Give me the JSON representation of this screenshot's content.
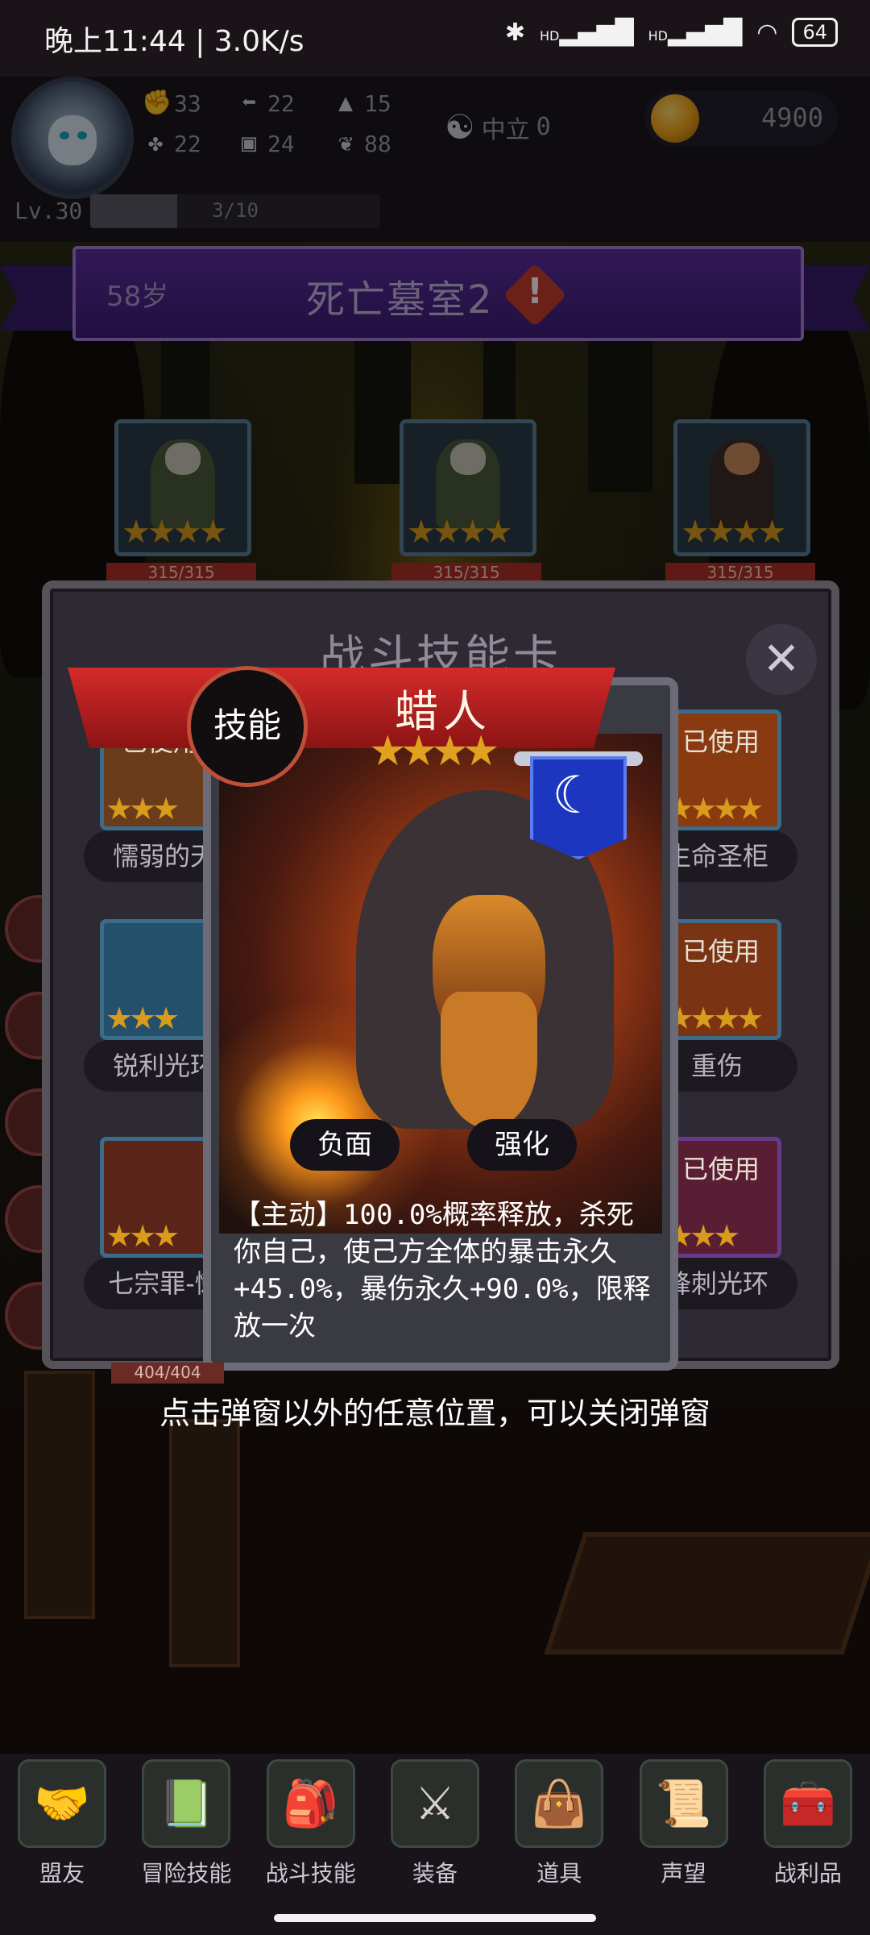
{
  "status_bar": {
    "time": "晚上11:44 | 3.0K/s",
    "signal_text": "HD",
    "battery": "64"
  },
  "hud": {
    "stats": [
      {
        "icon": "fist-icon",
        "value": "33"
      },
      {
        "icon": "boot-icon",
        "value": "22"
      },
      {
        "icon": "wizard-hat-icon",
        "value": "15"
      },
      {
        "icon": "clover-icon",
        "value": "22"
      },
      {
        "icon": "bag-icon",
        "value": "24"
      },
      {
        "icon": "lotus-icon",
        "value": "88"
      }
    ],
    "alignment_label": "中立",
    "alignment_value": "0",
    "gold": "4900",
    "level": "Lv.30",
    "xp_text": "3/10",
    "xp_progress": 0.3
  },
  "location": {
    "age": "58岁",
    "name": "死亡墓室2"
  },
  "enemies": [
    {
      "hp": "315/315",
      "stars": 4
    },
    {
      "hp": "315/315",
      "stars": 4
    },
    {
      "hp": "315/315",
      "stars": 4
    }
  ],
  "panel": {
    "title": "战斗技能卡",
    "close_icon": "close-icon",
    "slots": [
      {
        "label": "懦弱的天",
        "used": "已使用"
      },
      {
        "label": "生命圣柜",
        "used": "已使用"
      },
      {
        "label": "锐利光环",
        "used": ""
      },
      {
        "label": "重伤",
        "used": "已使用"
      },
      {
        "label": "七宗罪-懒",
        "used": ""
      },
      {
        "label": "锋刺光环",
        "used": "已使用"
      }
    ]
  },
  "card": {
    "badge": "技能",
    "name": "蜡人",
    "stars": 4,
    "element_icon": "moon-icon",
    "tags": [
      "负面",
      "强化"
    ],
    "description": "【主动】100.0%概率释放，杀死你自己，使己方全体的暴击永久+45.0%，暴伤永久+90.0%，限释放一次"
  },
  "hint": "点击弹窗以外的任意位置，可以关闭弹窗",
  "behind_hp": "404/404",
  "nav": [
    {
      "label": "盟友",
      "icon": "handshake-icon"
    },
    {
      "label": "冒险技能",
      "icon": "book-icon"
    },
    {
      "label": "战斗技能",
      "icon": "backpack-icon"
    },
    {
      "label": "装备",
      "icon": "crossed-swords-icon"
    },
    {
      "label": "道具",
      "icon": "satchel-icon"
    },
    {
      "label": "声望",
      "icon": "scroll-icon"
    },
    {
      "label": "战利品",
      "icon": "treasure-chest-icon"
    }
  ]
}
